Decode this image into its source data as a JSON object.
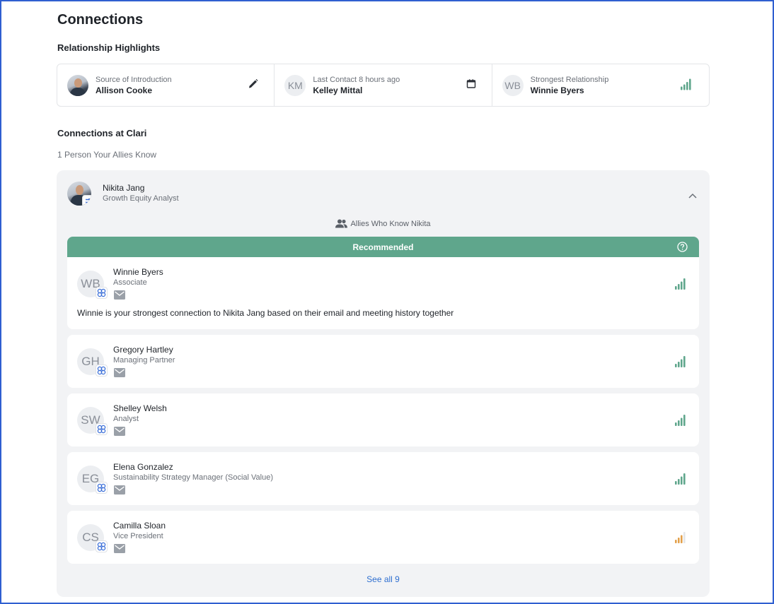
{
  "page": {
    "title": "Connections"
  },
  "highlights": {
    "title": "Relationship Highlights",
    "source": {
      "label": "Source of Introduction",
      "name": "Allison Cooke",
      "icon": "pencil-icon"
    },
    "last_contact": {
      "initials": "KM",
      "label": "Last Contact 8 hours ago",
      "name": "Kelley Mittal",
      "icon": "calendar-icon"
    },
    "strongest": {
      "initials": "WB",
      "label": "Strongest Relationship",
      "name": "Winnie Byers",
      "icon": "signal-bars-icon"
    }
  },
  "company": {
    "title": "Connections at Clari",
    "count_label": "1 Person Your Allies Know"
  },
  "target": {
    "name": "Nikita Jang",
    "role": "Growth Equity Analyst",
    "allies_label": "Allies Who Know Nikita"
  },
  "recommended_label": "Recommended",
  "allies": [
    {
      "initials": "WB",
      "name": "Winnie Byers",
      "role": "Associate",
      "strength": 4,
      "note": "Winnie is your strongest connection to Nikita Jang based on their email and meeting history together"
    },
    {
      "initials": "GH",
      "name": "Gregory Hartley",
      "role": "Managing Partner",
      "strength": 4
    },
    {
      "initials": "SW",
      "name": "Shelley Welsh",
      "role": "Analyst",
      "strength": 4
    },
    {
      "initials": "EG",
      "name": "Elena Gonzalez",
      "role": "Sustainability Strategy Manager (Social Value)",
      "strength": 4
    },
    {
      "initials": "CS",
      "name": "Camilla Sloan",
      "role": "Vice President",
      "strength": 3
    }
  ],
  "see_all_label": "See all 9",
  "colors": {
    "accent_green": "#5fa68c",
    "signal_strong": "#5fa68c",
    "signal_medium": "#e3a04a",
    "link": "#2f6fd0"
  }
}
